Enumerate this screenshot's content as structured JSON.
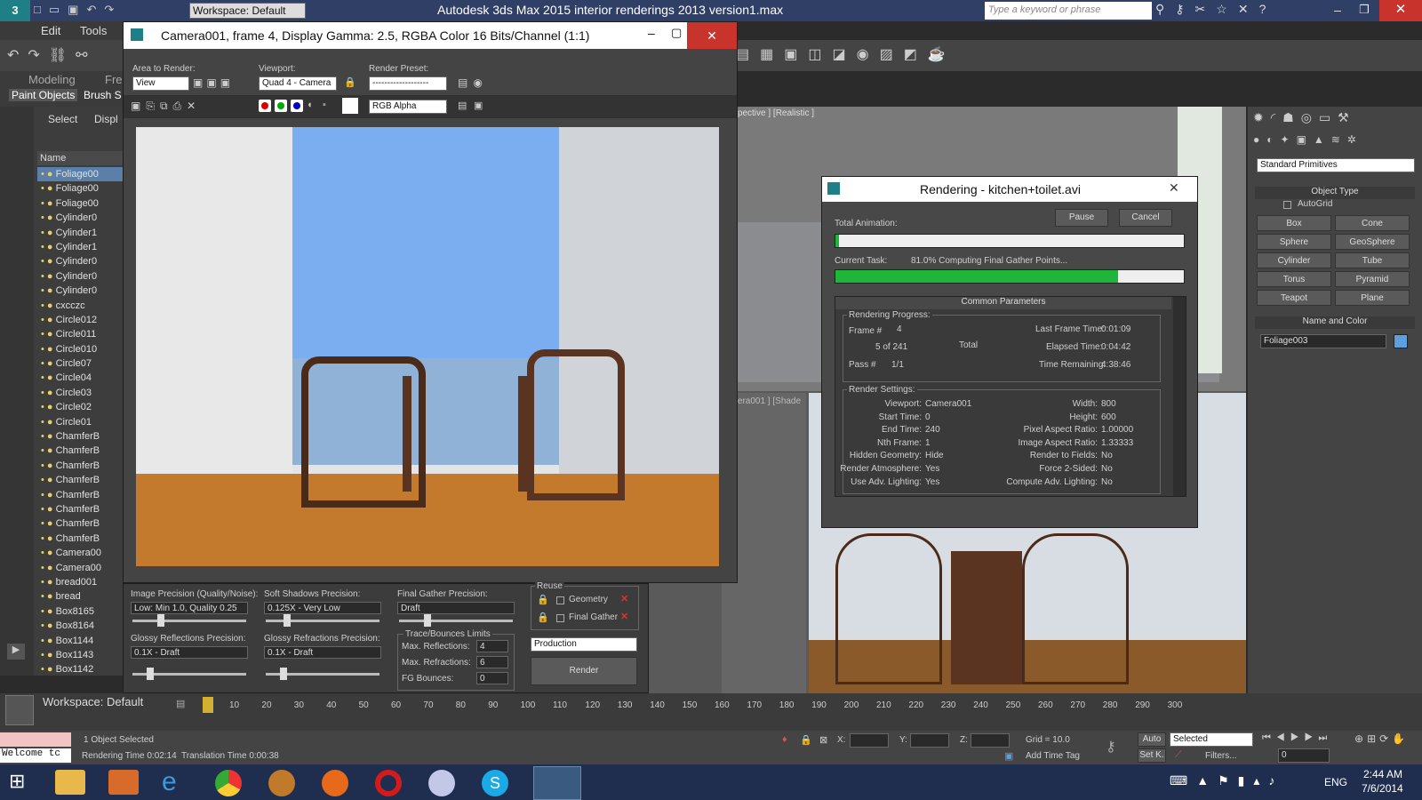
{
  "app": {
    "title": "Autodesk 3ds Max  2015     interior renderings 2013 version1.max",
    "workspace": "Workspace: Default",
    "search_placeholder": "Type a keyword or phrase",
    "menu": [
      "Edit",
      "Tools"
    ],
    "ribbon_tabs": [
      "Modeling",
      "Fre"
    ],
    "ribbon_sub": [
      "Paint Objects",
      "Brush S"
    ],
    "explorer_tabs": [
      "Select",
      "Displ"
    ],
    "name_header": "Name",
    "viewport_label": "erspective ] [Realistic ]",
    "viewport_label2": "amera001 ] [Shade"
  },
  "scene_items": [
    "Foliage00",
    "Foliage00",
    "Foliage00",
    "Cylinder0",
    "Cylinder1",
    "Cylinder1",
    "Cylinder0",
    "Cylinder0",
    "Cylinder0",
    "cxcczc",
    "Circle012",
    "Circle011",
    "Circle010",
    "Circle07",
    "Circle04",
    "Circle03",
    "Circle02",
    "Circle01",
    "ChamferB",
    "ChamferB",
    "ChamferB",
    "ChamferB",
    "ChamferB",
    "ChamferB",
    "ChamferB",
    "ChamferB",
    "Camera00",
    "Camera00",
    "bread001",
    "bread",
    "Box8165",
    "Box8164",
    "Box1144",
    "Box1143",
    "Box1142"
  ],
  "frame_window": {
    "title": "Camera001, frame 4, Display Gamma: 2.5, RGBA Color 16 Bits/Channel (1:1)",
    "area_label": "Area to Render:",
    "area_value": "View",
    "viewport_label": "Viewport:",
    "viewport_value": "Quad 4 - Camera",
    "preset_label": "Render Preset:",
    "preset_value": "-------------------",
    "channel_value": "RGB Alpha"
  },
  "render_settings": {
    "image_precision_label": "Image Precision (Quality/Noise):",
    "image_precision_value": "Low: Min 1.0, Quality 0.25",
    "soft_shadows_label": "Soft Shadows Precision:",
    "soft_shadows_value": "0.125X - Very Low",
    "final_gather_label": "Final Gather Precision:",
    "final_gather_value": "Draft",
    "glossy_refl_label": "Glossy Reflections Precision:",
    "glossy_refl_value": "0.1X - Draft",
    "glossy_refr_label": "Glossy Refractions Precision:",
    "glossy_refr_value": "0.1X - Draft",
    "trace_label": "Trace/Bounces Limits",
    "max_refl_label": "Max. Reflections:",
    "max_refl_value": "4",
    "max_refr_label": "Max. Refractions:",
    "max_refr_value": "6",
    "fg_bounces_label": "FG Bounces:",
    "fg_bounces_value": "0",
    "reuse_label": "Reuse",
    "geometry_label": "Geometry",
    "final_gather_reuse_label": "Final Gather",
    "mode_value": "Production",
    "render_button": "Render"
  },
  "rendering_dialog": {
    "title": "Rendering - kitchen+toilet.avi",
    "total_animation_label": "Total Animation:",
    "pause": "Pause",
    "cancel": "Cancel",
    "current_task_label": "Current Task:",
    "current_task_value": "81.0%  Computing Final Gather Points...",
    "current_task_progress": 0.81,
    "total_progress": 0.01,
    "common_params": "Common Parameters",
    "progress_header": "Rendering Progress:",
    "frame_label": "Frame #",
    "frame_value": "4",
    "of_value": "5  of  241",
    "total_label": "Total",
    "pass_label": "Pass #",
    "pass_value": "1/1",
    "last_frame_label": "Last Frame Time:",
    "last_frame_value": "0:01:09",
    "elapsed_label": "Elapsed Time:",
    "elapsed_value": "0:04:42",
    "remaining_label": "Time Remaining:",
    "remaining_value": "4:38:46",
    "settings_header": "Render Settings:",
    "settings_left": [
      [
        "Viewport:",
        "Camera001"
      ],
      [
        "Start Time:",
        "0"
      ],
      [
        "End Time:",
        "240"
      ],
      [
        "Nth Frame:",
        "1"
      ],
      [
        "Hidden Geometry:",
        "Hide"
      ],
      [
        "Render Atmosphere:",
        "Yes"
      ],
      [
        "Use Adv. Lighting:",
        "Yes"
      ]
    ],
    "settings_right": [
      [
        "Width:",
        "800"
      ],
      [
        "Height:",
        "600"
      ],
      [
        "Pixel Aspect Ratio:",
        "1.00000"
      ],
      [
        "Image Aspect Ratio:",
        "1.33333"
      ],
      [
        "Render to Fields:",
        "No"
      ],
      [
        "Force 2-Sided:",
        "No"
      ],
      [
        "Compute Adv. Lighting:",
        "No"
      ]
    ]
  },
  "command_panel": {
    "dropdown": "Standard Primitives",
    "object_type": "Object Type",
    "autogrid": "AutoGrid",
    "buttons": [
      "Box",
      "Cone",
      "Sphere",
      "GeoSphere",
      "Cylinder",
      "Tube",
      "Torus",
      "Pyramid",
      "Teapot",
      "Plane"
    ],
    "name_color": "Name and Color",
    "object_name": "Foliage003",
    "object_color": "#5da0e0"
  },
  "timeline": {
    "ticks": [
      "10",
      "20",
      "30",
      "40",
      "50",
      "60",
      "70",
      "80",
      "90",
      "100",
      "110",
      "120",
      "130",
      "140",
      "150",
      "160",
      "170",
      "180",
      "190",
      "200",
      "210",
      "220",
      "230",
      "240",
      "250",
      "260",
      "270",
      "280",
      "290",
      "300"
    ],
    "workspace_label": "Workspace: Default"
  },
  "status": {
    "selected": "1 Object Selected",
    "rendering_time": "Rendering Time  0:02:14",
    "translation_time": "Translation Time  0:00:38",
    "welcome": "Welcome tc",
    "x_label": "X:",
    "y_label": "Y:",
    "z_label": "Z:",
    "grid": "Grid = 10.0",
    "add_time_tag": "Add Time Tag",
    "auto": "Auto",
    "set_key": "Set K.",
    "selected_dd": "Selected",
    "filters": "Filters...",
    "frame_field": "0"
  },
  "taskbar": {
    "time": "2:44 AM",
    "date": "7/6/2014",
    "lang": "ENG"
  }
}
